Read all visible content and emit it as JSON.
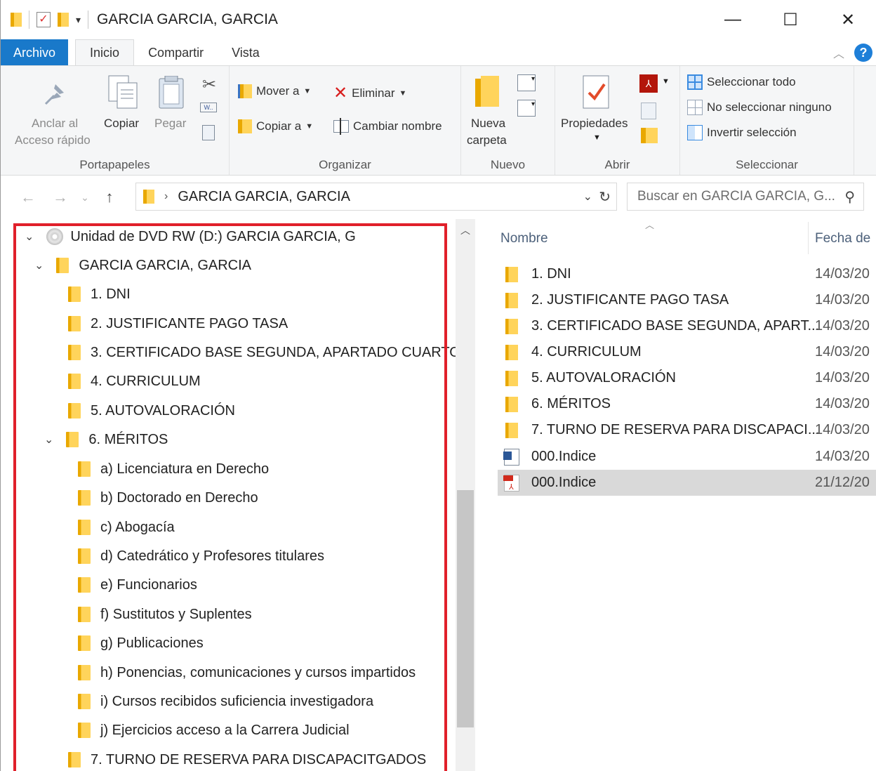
{
  "window": {
    "title": "GARCIA GARCIA, GARCIA",
    "minimize": "—",
    "maximize": "☐",
    "close": "✕"
  },
  "tabs": {
    "file": "Archivo",
    "items": [
      "Inicio",
      "Compartir",
      "Vista"
    ],
    "help": "?"
  },
  "ribbon": {
    "portapapeles": {
      "pin_line1": "Anclar al",
      "pin_line2": "Acceso rápido",
      "copy": "Copiar",
      "paste": "Pegar",
      "label": "Portapapeles"
    },
    "organizar": {
      "move": "Mover a",
      "copyto": "Copiar a",
      "delete": "Eliminar",
      "rename": "Cambiar nombre",
      "label": "Organizar"
    },
    "nuevo": {
      "newfolder_line1": "Nueva",
      "newfolder_line2": "carpeta",
      "label": "Nuevo"
    },
    "abrir": {
      "properties": "Propiedades",
      "label": "Abrir"
    },
    "seleccionar": {
      "all": "Seleccionar todo",
      "none": "No seleccionar ninguno",
      "invert": "Invertir selección",
      "label": "Seleccionar"
    }
  },
  "address": {
    "path": "GARCIA GARCIA, GARCIA",
    "search_placeholder": "Buscar en GARCIA GARCIA, G..."
  },
  "tree": {
    "drive": "Unidad de DVD RW (D:) GARCIA GARCIA, G",
    "root": "GARCIA GARCIA, GARCIA",
    "folders": [
      "1. DNI",
      "2. JUSTIFICANTE PAGO TASA",
      "3. CERTIFICADO BASE SEGUNDA, APARTADO CUARTO",
      "4. CURRICULUM",
      "5. AUTOVALORACIÓN",
      "6. MÉRITOS"
    ],
    "meritos": [
      "a) Licenciatura en Derecho",
      "b) Doctorado en Derecho",
      "c) Abogacía",
      "d) Catedrático y Profesores titulares",
      "e) Funcionarios",
      "f) Sustitutos y Suplentes",
      "g) Publicaciones",
      "h) Ponencias, comunicaciones y cursos impartidos",
      "i) Cursos recibidos suficiencia investigadora",
      "j) Ejercicios acceso a la Carrera Judicial"
    ],
    "last": "7. TURNO DE RESERVA PARA DISCAPACITGADOS"
  },
  "list": {
    "col_name": "Nombre",
    "col_date": "Fecha de",
    "rows": [
      {
        "name": "1. DNI",
        "date": "14/03/20",
        "type": "folder"
      },
      {
        "name": "2. JUSTIFICANTE PAGO TASA",
        "date": "14/03/20",
        "type": "folder"
      },
      {
        "name": "3. CERTIFICADO BASE SEGUNDA, APART...",
        "date": "14/03/20",
        "type": "folder"
      },
      {
        "name": "4. CURRICULUM",
        "date": "14/03/20",
        "type": "folder"
      },
      {
        "name": "5. AUTOVALORACIÓN",
        "date": "14/03/20",
        "type": "folder"
      },
      {
        "name": "6. MÉRITOS",
        "date": "14/03/20",
        "type": "folder"
      },
      {
        "name": "7. TURNO DE RESERVA PARA DISCAPACI...",
        "date": "14/03/20",
        "type": "folder"
      },
      {
        "name": "000.Indice",
        "date": "14/03/20",
        "type": "word"
      },
      {
        "name": "000.Indice",
        "date": "21/12/20",
        "type": "pdf",
        "selected": true
      }
    ]
  },
  "colors": {
    "accent": "#1979ca",
    "highlight": "#e0202a",
    "folder": "#ffd45b"
  }
}
